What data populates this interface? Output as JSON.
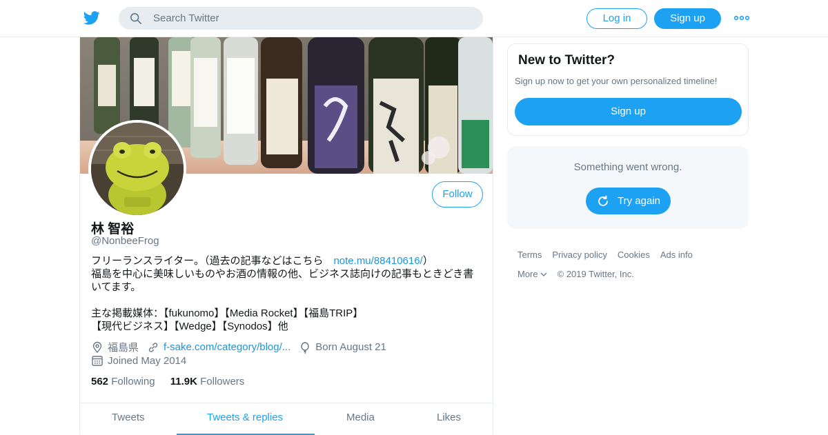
{
  "nav": {
    "search_placeholder": "Search Twitter",
    "login_label": "Log in",
    "signup_label": "Sign up"
  },
  "profile": {
    "name": "林 智裕",
    "handle": "@NonbeeFrog",
    "follow_label": "Follow",
    "bio": {
      "line1_prefix": "フリーランスライター。（過去の記事などはこちら　",
      "line1_link": "note.mu/88410616/",
      "line1_suffix": "）",
      "line2": "福島を中心に美味しいものやお酒の情報の他、ビジネス誌向けの記事もときどき書",
      "line3": "いてます。",
      "line4": "主な掲載媒体：【fukunomo】【Media Rocket】【福島TRIP】",
      "line5": "【現代ビジネス】【Wedge】【Synodos】他"
    },
    "location": "福島県",
    "website": "f-sake.com/category/blog/...",
    "birthday": "Born August 21",
    "joined": "Joined May 2014",
    "following_count": "562",
    "following_label": "Following",
    "followers_count": "11.9K",
    "followers_label": "Followers",
    "tabs": [
      "Tweets",
      "Tweets & replies",
      "Media",
      "Likes"
    ],
    "active_tab": "Tweets & replies"
  },
  "sidebar": {
    "new_title": "New to Twitter?",
    "new_text": "Sign up now to get your own personalized timeline!",
    "new_signup_label": "Sign up",
    "error_text": "Something went wrong.",
    "retry_label": "Try again"
  },
  "footer": {
    "links": [
      "Terms",
      "Privacy policy",
      "Cookies",
      "Ads info"
    ],
    "more_label": "More",
    "copyright": "© 2019 Twitter, Inc."
  },
  "colors": {
    "accent": "#1da1f2",
    "link": "#1b95e0",
    "muted": "#657786",
    "border": "#e6ecf0"
  }
}
